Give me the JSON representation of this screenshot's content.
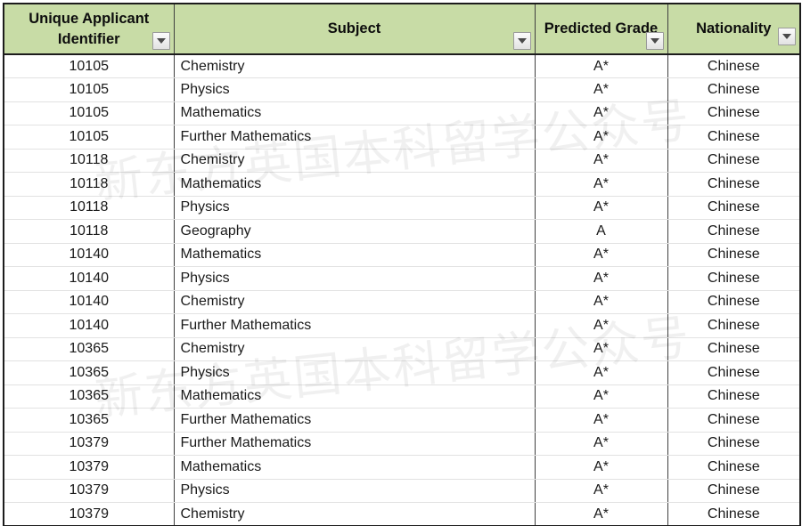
{
  "watermark": {
    "text": "新东方英国本科留学公众号",
    "color": "#000000"
  },
  "theme": {
    "header_fill": "#c8dca6",
    "header_text": "#0d0d0d",
    "body_text": "#1a1a1a",
    "grid_line": "#e2e2e2",
    "border_dark": "#1c1c1c"
  },
  "table": {
    "columns": [
      {
        "key": "uai",
        "label": "Unique Applicant Identifier",
        "align": "center",
        "filter_icon": "filter-dropdown-icon"
      },
      {
        "key": "subj",
        "label": "Subject",
        "align": "left",
        "filter_icon": "filter-dropdown-icon"
      },
      {
        "key": "grade",
        "label": "Predicted Grade",
        "align": "center",
        "filter_icon": "filter-dropdown-icon"
      },
      {
        "key": "nat",
        "label": "Nationality",
        "align": "center",
        "filter_icon": "filter-dropdown-icon"
      }
    ],
    "rows": [
      {
        "uai": "10105",
        "subj": "Chemistry",
        "grade": "A*",
        "nat": "Chinese"
      },
      {
        "uai": "10105",
        "subj": "Physics",
        "grade": "A*",
        "nat": "Chinese"
      },
      {
        "uai": "10105",
        "subj": "Mathematics",
        "grade": "A*",
        "nat": "Chinese"
      },
      {
        "uai": "10105",
        "subj": "Further Mathematics",
        "grade": "A*",
        "nat": "Chinese"
      },
      {
        "uai": "10118",
        "subj": "Chemistry",
        "grade": "A*",
        "nat": "Chinese"
      },
      {
        "uai": "10118",
        "subj": "Mathematics",
        "grade": "A*",
        "nat": "Chinese"
      },
      {
        "uai": "10118",
        "subj": "Physics",
        "grade": "A*",
        "nat": "Chinese"
      },
      {
        "uai": "10118",
        "subj": "Geography",
        "grade": "A",
        "nat": "Chinese"
      },
      {
        "uai": "10140",
        "subj": "Mathematics",
        "grade": "A*",
        "nat": "Chinese"
      },
      {
        "uai": "10140",
        "subj": "Physics",
        "grade": "A*",
        "nat": "Chinese"
      },
      {
        "uai": "10140",
        "subj": "Chemistry",
        "grade": "A*",
        "nat": "Chinese"
      },
      {
        "uai": "10140",
        "subj": "Further Mathematics",
        "grade": "A*",
        "nat": "Chinese"
      },
      {
        "uai": "10365",
        "subj": "Chemistry",
        "grade": "A*",
        "nat": "Chinese"
      },
      {
        "uai": "10365",
        "subj": "Physics",
        "grade": "A*",
        "nat": "Chinese"
      },
      {
        "uai": "10365",
        "subj": "Mathematics",
        "grade": "A*",
        "nat": "Chinese"
      },
      {
        "uai": "10365",
        "subj": "Further Mathematics",
        "grade": "A*",
        "nat": "Chinese"
      },
      {
        "uai": "10379",
        "subj": "Further Mathematics",
        "grade": "A*",
        "nat": "Chinese"
      },
      {
        "uai": "10379",
        "subj": "Mathematics",
        "grade": "A*",
        "nat": "Chinese"
      },
      {
        "uai": "10379",
        "subj": "Physics",
        "grade": "A*",
        "nat": "Chinese"
      },
      {
        "uai": "10379",
        "subj": "Chemistry",
        "grade": "A*",
        "nat": "Chinese"
      }
    ]
  }
}
